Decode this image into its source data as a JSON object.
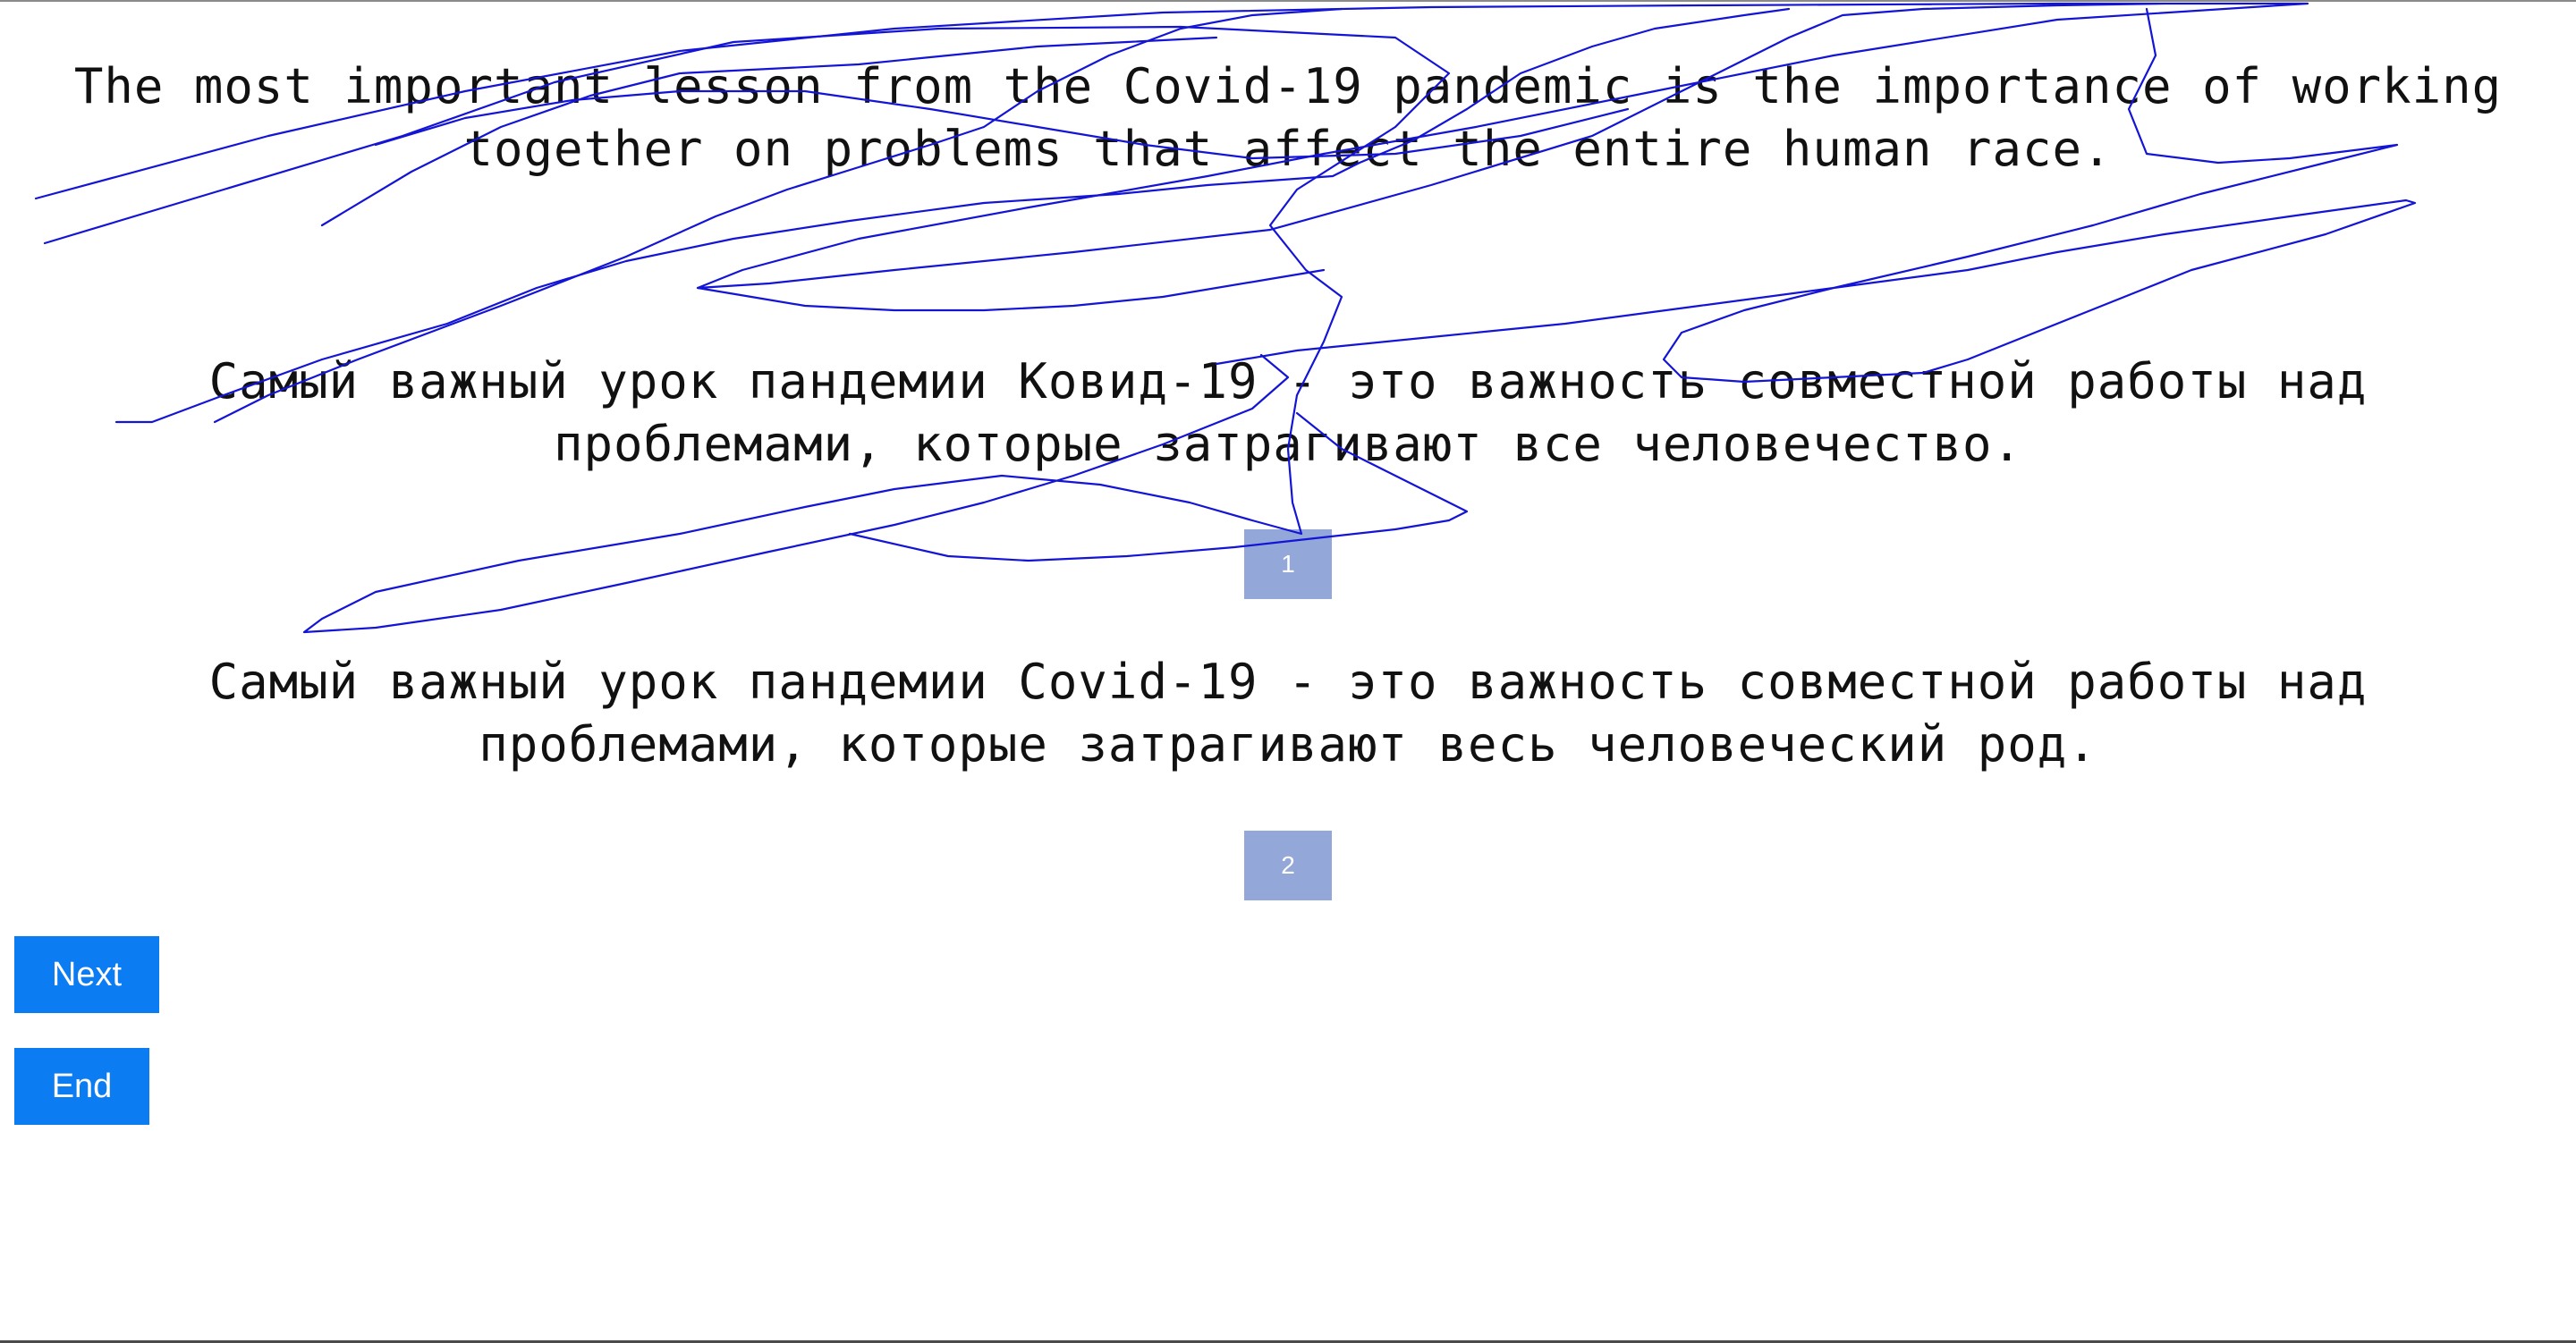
{
  "source_sentence": "The most important lesson from the Covid-19 pandemic is the importance of working together on problems that affect the entire human race.",
  "candidates": [
    {
      "text": "Самый важный урок пандемии Ковид-19 - это важность совместной работы над проблемами, которые затрагивают все человечество.",
      "choice_label": "1"
    },
    {
      "text": "Самый важный урок пандемии Covid-19 - это важность совместной работы над проблемами, которые затрагивают весь человеческий род.",
      "choice_label": "2"
    }
  ],
  "buttons": {
    "next_label": "Next",
    "end_label": "End"
  },
  "colors": {
    "choice_button": "#93a8d8",
    "nav_button": "#0c7cf2",
    "scribble_stroke": "#1414d6"
  }
}
